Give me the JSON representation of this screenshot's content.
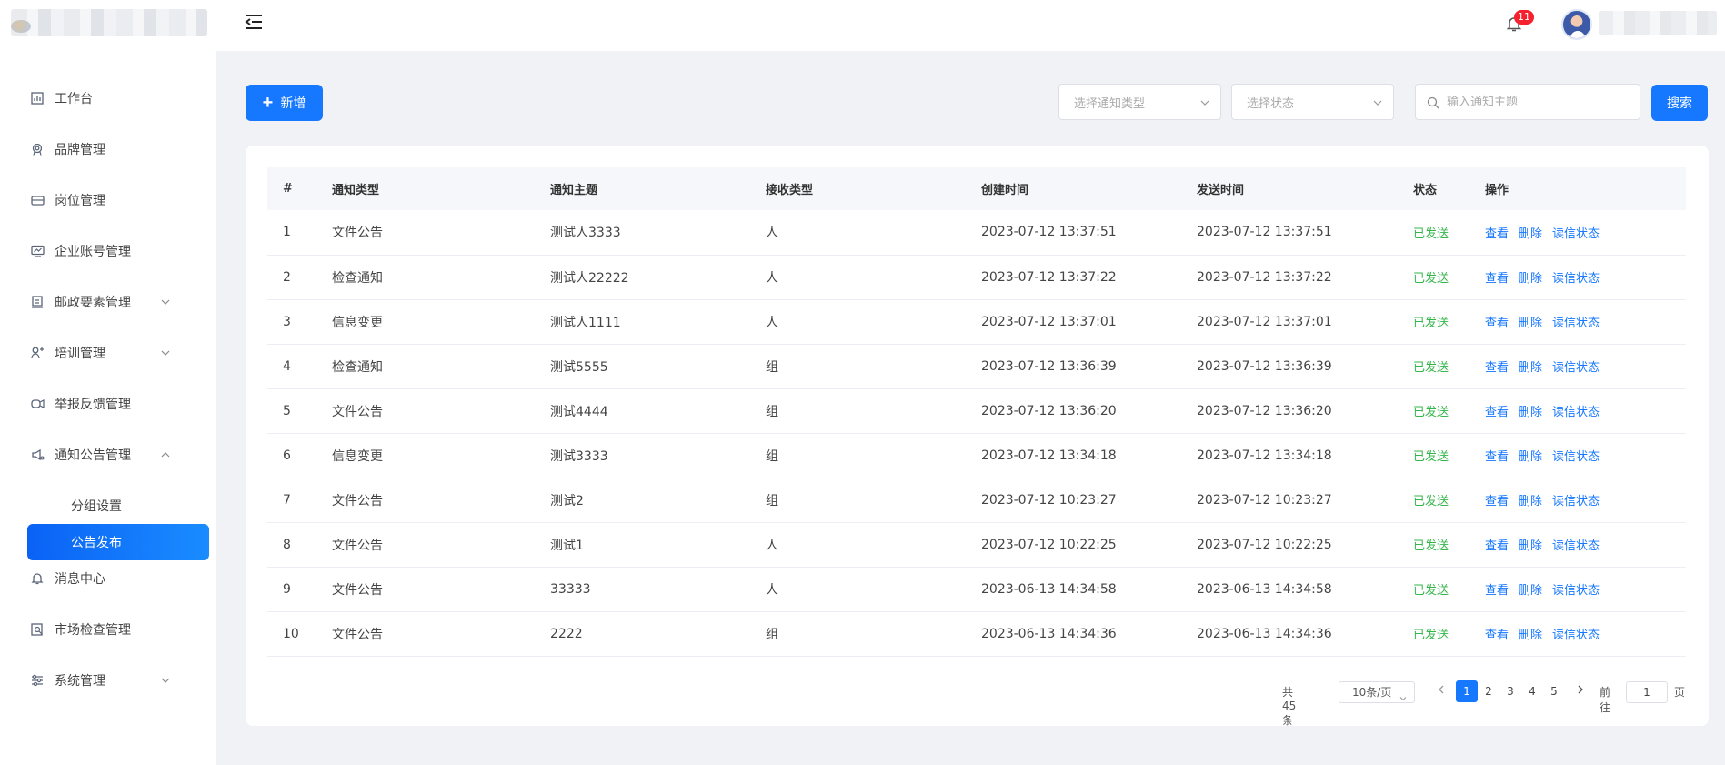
{
  "header": {
    "notification_count": "11"
  },
  "sidebar": {
    "items": [
      {
        "label": "工作台",
        "icon": "dashboard-chart-icon"
      },
      {
        "label": "品牌管理",
        "icon": "brand-badge-icon"
      },
      {
        "label": "岗位管理",
        "icon": "position-icon"
      },
      {
        "label": "企业账号管理",
        "icon": "monitor-icon"
      },
      {
        "label": "邮政要素管理",
        "icon": "postal-icon",
        "expandable": true
      },
      {
        "label": "培训管理",
        "icon": "training-icon",
        "expandable": true
      },
      {
        "label": "举报反馈管理",
        "icon": "feedback-icon"
      },
      {
        "label": "通知公告管理",
        "icon": "announcement-icon",
        "expanded": true
      },
      {
        "label": "消息中心",
        "icon": "bell-icon"
      },
      {
        "label": "市场检查管理",
        "icon": "inspection-icon"
      },
      {
        "label": "系统管理",
        "icon": "settings-sliders-icon",
        "expandable": true
      }
    ],
    "subitems": [
      {
        "label": "分组设置"
      },
      {
        "label": "公告发布",
        "active": true
      }
    ]
  },
  "toolbar": {
    "add_label": "新增",
    "type_select_placeholder": "选择通知类型",
    "status_select_placeholder": "选择状态",
    "search_placeholder": "输入通知主题",
    "search_label": "搜索"
  },
  "table": {
    "columns": [
      "#",
      "通知类型",
      "通知主题",
      "接收类型",
      "创建时间",
      "发送时间",
      "状态",
      "操作"
    ],
    "rows": [
      {
        "no": "1",
        "type": "文件公告",
        "subject": "测试人3333",
        "receiver": "人",
        "created": "2023-07-12 13:37:51",
        "sent": "2023-07-12 13:37:51",
        "status": "已发送"
      },
      {
        "no": "2",
        "type": "检查通知",
        "subject": "测试人22222",
        "receiver": "人",
        "created": "2023-07-12 13:37:22",
        "sent": "2023-07-12 13:37:22",
        "status": "已发送"
      },
      {
        "no": "3",
        "type": "信息变更",
        "subject": "测试人1111",
        "receiver": "人",
        "created": "2023-07-12 13:37:01",
        "sent": "2023-07-12 13:37:01",
        "status": "已发送"
      },
      {
        "no": "4",
        "type": "检查通知",
        "subject": "测试5555",
        "receiver": "组",
        "created": "2023-07-12 13:36:39",
        "sent": "2023-07-12 13:36:39",
        "status": "已发送"
      },
      {
        "no": "5",
        "type": "文件公告",
        "subject": "测试4444",
        "receiver": "组",
        "created": "2023-07-12 13:36:20",
        "sent": "2023-07-12 13:36:20",
        "status": "已发送"
      },
      {
        "no": "6",
        "type": "信息变更",
        "subject": "测试3333",
        "receiver": "组",
        "created": "2023-07-12 13:34:18",
        "sent": "2023-07-12 13:34:18",
        "status": "已发送"
      },
      {
        "no": "7",
        "type": "文件公告",
        "subject": "测试2",
        "receiver": "组",
        "created": "2023-07-12 10:23:27",
        "sent": "2023-07-12 10:23:27",
        "status": "已发送"
      },
      {
        "no": "8",
        "type": "文件公告",
        "subject": "测试1",
        "receiver": "人",
        "created": "2023-07-12 10:22:25",
        "sent": "2023-07-12 10:22:25",
        "status": "已发送"
      },
      {
        "no": "9",
        "type": "文件公告",
        "subject": "33333",
        "receiver": "人",
        "created": "2023-06-13 14:34:58",
        "sent": "2023-06-13 14:34:58",
        "status": "已发送"
      },
      {
        "no": "10",
        "type": "文件公告",
        "subject": "2222",
        "receiver": "组",
        "created": "2023-06-13 14:34:36",
        "sent": "2023-06-13 14:34:36",
        "status": "已发送"
      }
    ],
    "actions": {
      "view": "查看",
      "delete": "删除",
      "read_status": "读信状态"
    }
  },
  "pagination": {
    "total": "共 45 条",
    "page_size": "10条/页",
    "pages": [
      "1",
      "2",
      "3",
      "4",
      "5"
    ],
    "current": "1",
    "goto_prefix": "前往",
    "goto_value": "1",
    "goto_suffix": "页"
  },
  "colors": {
    "primary": "#1677ff",
    "status_sent": "#34b54a",
    "badge": "#f5222d"
  }
}
